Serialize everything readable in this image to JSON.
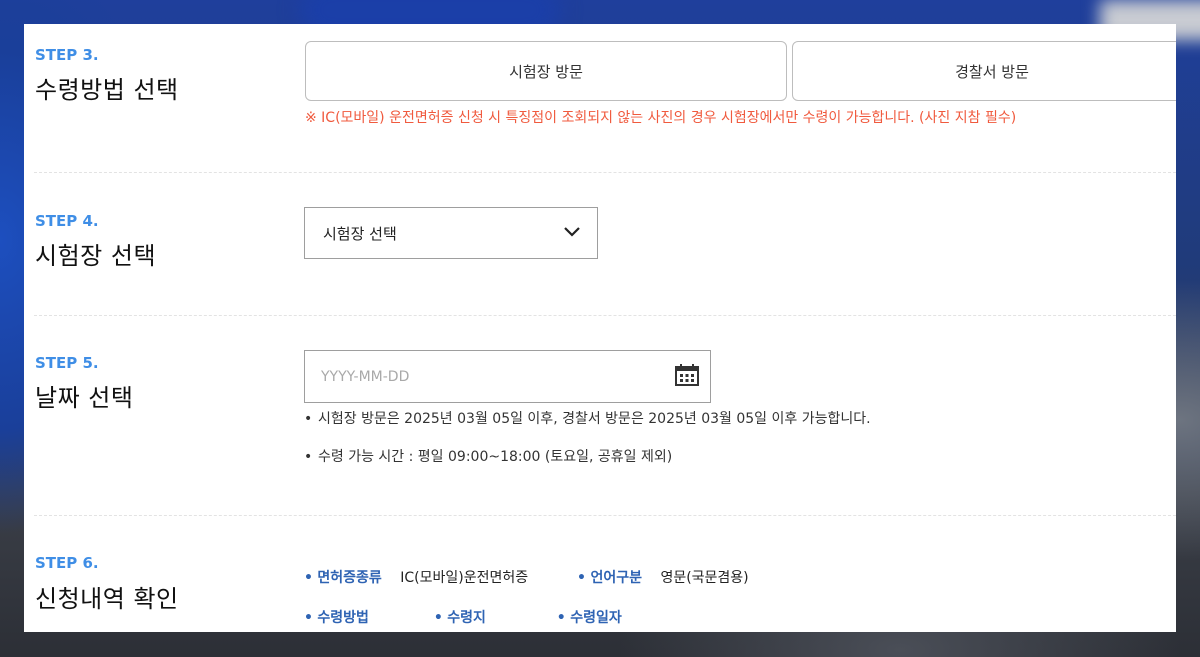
{
  "steps": [
    {
      "step": "STEP 3.",
      "title": "수령방법 선택"
    },
    {
      "step": "STEP 4.",
      "title": "시험장 선택"
    },
    {
      "step": "STEP 5.",
      "title": "날짜 선택"
    },
    {
      "step": "STEP 6.",
      "title": "신청내역 확인"
    }
  ],
  "receipt_method": {
    "options": [
      "시험장 방문",
      "경찰서 방문"
    ],
    "warning": "※ IC(모바일) 운전면허증 신청 시 특징점이 조회되지 않는 사진의 경우 시험장에서만 수령이 가능합니다. (사진 지참 필수)"
  },
  "test_site": {
    "selected": "시험장 선택",
    "icon": "chevron-down-icon"
  },
  "date": {
    "placeholder": "YYYY-MM-DD",
    "icon": "calendar-icon",
    "notes": [
      "시험장 방문은 2025년 03월 05일 이후, 경찰서 방문은 2025년 03월 05일 이후 가능합니다.",
      "수령 가능 시간 : 평일 09:00~18:00 (토요일, 공휴일 제외)"
    ]
  },
  "summary": {
    "bullet": "•",
    "license_type_label": "면허증종류",
    "license_type_value": "IC(모바일)운전면허증",
    "language_label": "언어구분",
    "language_value": "영문(국문겸용)",
    "receipt_method_label": "수령방법",
    "receipt_place_label": "수령지",
    "receipt_date_label": "수령일자"
  },
  "colors": {
    "step_accent": "#3f8ee6",
    "warning": "#f05a3e",
    "summary_key": "#2e63b3"
  }
}
